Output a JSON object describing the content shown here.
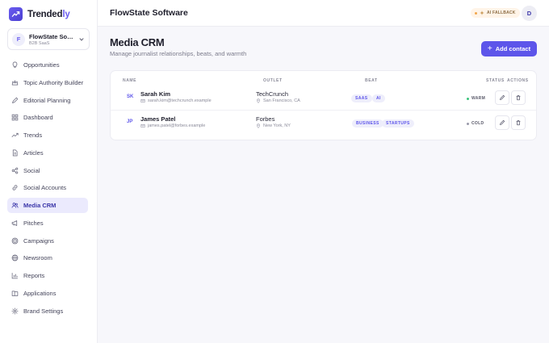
{
  "brand": {
    "name_main": "Trended",
    "name_accent": "ly",
    "accent": "#6a5cf0"
  },
  "workspace": {
    "initial": "F",
    "name": "FlowState Software",
    "subtitle": "B2B SaaS"
  },
  "nav": [
    {
      "label": "Opportunities",
      "icon": "lightbulb-icon"
    },
    {
      "label": "Topic Authority Builder",
      "icon": "crown-icon"
    },
    {
      "label": "Editorial Planning",
      "icon": "pen-icon"
    },
    {
      "label": "Dashboard",
      "icon": "grid-icon"
    },
    {
      "label": "Trends",
      "icon": "trend-icon"
    },
    {
      "label": "Articles",
      "icon": "document-icon"
    },
    {
      "label": "Social",
      "icon": "share-icon"
    },
    {
      "label": "Social Accounts",
      "icon": "link-icon"
    },
    {
      "label": "Media CRM",
      "icon": "users-icon",
      "active": true
    },
    {
      "label": "Pitches",
      "icon": "megaphone-icon"
    },
    {
      "label": "Campaigns",
      "icon": "target-icon"
    },
    {
      "label": "Newsroom",
      "icon": "globe-icon"
    },
    {
      "label": "Reports",
      "icon": "chart-icon"
    },
    {
      "label": "Applications",
      "icon": "apps-icon"
    },
    {
      "label": "Brand Settings",
      "icon": "gear-icon"
    }
  ],
  "topbar": {
    "title": "FlowState Software",
    "ai_badge": "AI FALLBACK",
    "user_initial": "D"
  },
  "page": {
    "title": "Media CRM",
    "subtitle": "Manage journalist relationships, beats, and warmth",
    "add_button": "Add contact"
  },
  "table": {
    "headers": {
      "name": "NAME",
      "outlet": "OUTLET",
      "beat": "BEAT",
      "status": "STATUS",
      "actions": "ACTIONS"
    },
    "rows": [
      {
        "initials": "SK",
        "name": "Sarah Kim",
        "email": "sarah.kim@techcrunch.example",
        "outlet": "TechCrunch",
        "location": "San Francisco, CA",
        "beats": [
          "SAAS",
          "AI"
        ],
        "status": "WARM",
        "status_color": "#3cc47c"
      },
      {
        "initials": "JP",
        "name": "James Patel",
        "email": "james.patel@forbes.example",
        "outlet": "Forbes",
        "location": "New York, NY",
        "beats": [
          "BUSINESS",
          "STARTUPS"
        ],
        "status": "COLD",
        "status_color": "#9a9aaa"
      }
    ]
  }
}
